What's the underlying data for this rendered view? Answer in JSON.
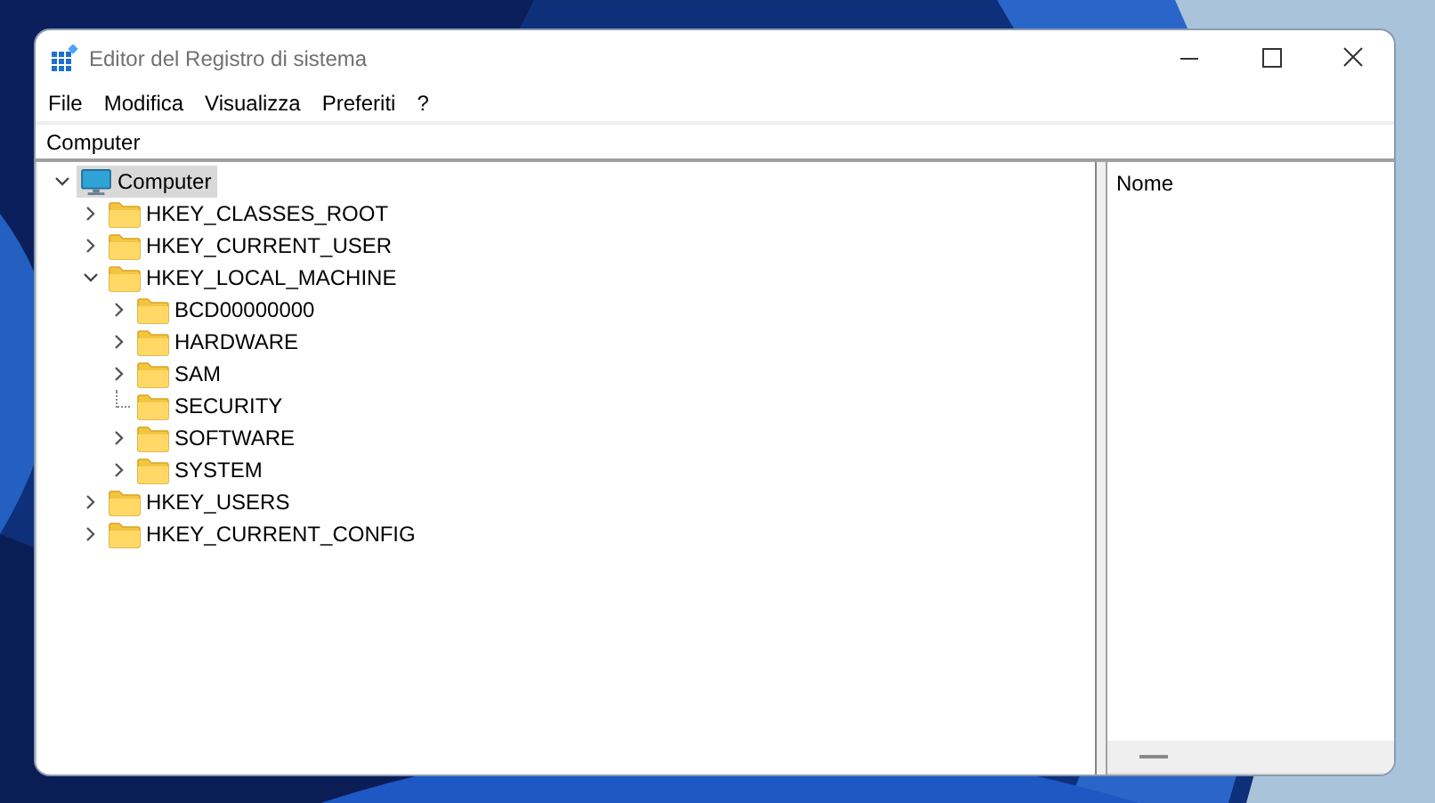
{
  "window": {
    "title": "Editor del Registro di sistema"
  },
  "menu": [
    "File",
    "Modifica",
    "Visualizza",
    "Preferiti",
    "?"
  ],
  "address": "Computer",
  "tree": [
    {
      "label": "Computer",
      "kind": "computer",
      "selected": true,
      "expandable": true,
      "expanded": true,
      "children": [
        {
          "label": "HKEY_CLASSES_ROOT",
          "kind": "folder",
          "selected": false,
          "expandable": true,
          "expanded": false
        },
        {
          "label": "HKEY_CURRENT_USER",
          "kind": "folder",
          "selected": false,
          "expandable": true,
          "expanded": false
        },
        {
          "label": "HKEY_LOCAL_MACHINE",
          "kind": "folder",
          "selected": false,
          "expandable": true,
          "expanded": true,
          "children": [
            {
              "label": "BCD00000000",
              "kind": "folder",
              "selected": false,
              "expandable": true,
              "expanded": false
            },
            {
              "label": "HARDWARE",
              "kind": "folder",
              "selected": false,
              "expandable": true,
              "expanded": false
            },
            {
              "label": "SAM",
              "kind": "folder",
              "selected": false,
              "expandable": true,
              "expanded": false
            },
            {
              "label": "SECURITY",
              "kind": "folder",
              "selected": false,
              "expandable": false,
              "expanded": false
            },
            {
              "label": "SOFTWARE",
              "kind": "folder",
              "selected": false,
              "expandable": true,
              "expanded": false
            },
            {
              "label": "SYSTEM",
              "kind": "folder",
              "selected": false,
              "expandable": true,
              "expanded": false
            }
          ]
        },
        {
          "label": "HKEY_USERS",
          "kind": "folder",
          "selected": false,
          "expandable": true,
          "expanded": false
        },
        {
          "label": "HKEY_CURRENT_CONFIG",
          "kind": "folder",
          "selected": false,
          "expandable": true,
          "expanded": false
        }
      ]
    }
  ],
  "values_pane": {
    "columns": [
      "Nome"
    ]
  }
}
